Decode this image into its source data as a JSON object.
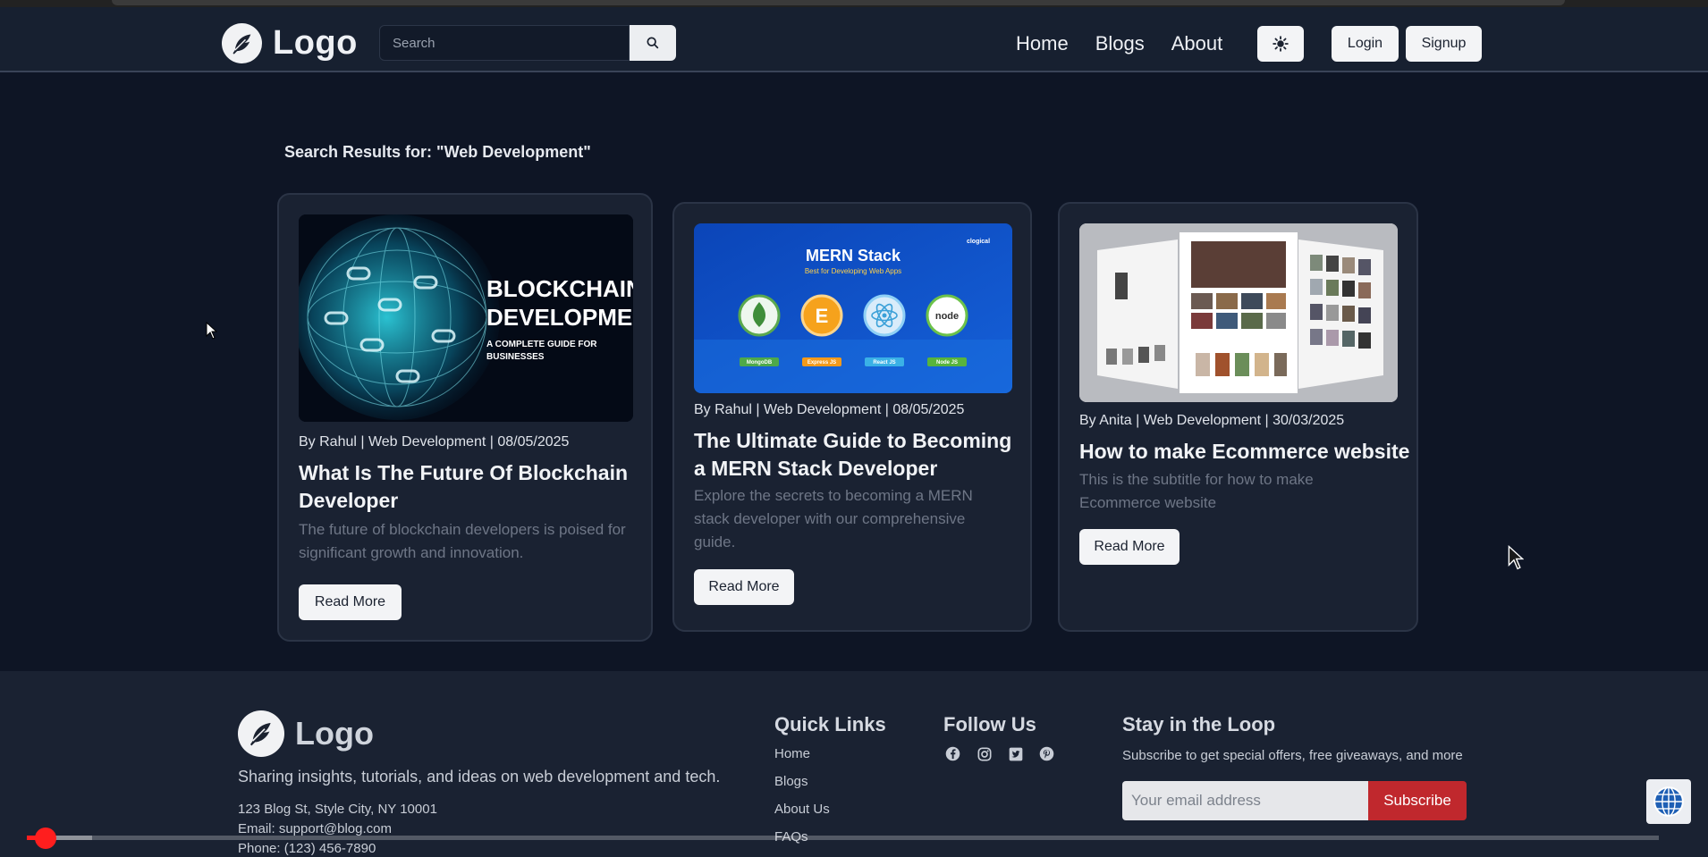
{
  "header": {
    "brand": "Logo",
    "search_placeholder": "Search",
    "nav": [
      "Home",
      "Blogs",
      "About"
    ],
    "login_label": "Login",
    "signup_label": "Signup"
  },
  "main": {
    "results_title": "Search Results for: \"Web Development\"",
    "cards": [
      {
        "image_text_line1": "BLOCKCHAIN",
        "image_text_line2": "DEVELOPMENT",
        "image_text_line3": "A COMPLETE GUIDE FOR",
        "image_text_line4": "BUSINESSES",
        "meta": "By Rahul | Web Development | 08/05/2025",
        "title": "What Is The Future Of Blockchain Developer",
        "subtitle": "The future of blockchain developers is poised for significant growth and innovation.",
        "button": "Read More"
      },
      {
        "image_title": "MERN Stack",
        "image_subtitle": "Best for Developing Web Apps",
        "image_tags": [
          "MongoDB",
          "Express JS",
          "React JS",
          "Node JS"
        ],
        "image_brand": "clogical",
        "meta": "By Rahul | Web Development | 08/05/2025",
        "title": "The Ultimate Guide to Becoming a MERN Stack Developer",
        "subtitle": "Explore the secrets to becoming a MERN stack developer with our comprehensive guide.",
        "button": "Read More"
      },
      {
        "meta": "By Anita | Web Development | 30/03/2025",
        "title": "How to make Ecommerce website",
        "subtitle": "This is the subtitle for how to make Ecommerce website",
        "button": "Read More"
      }
    ]
  },
  "footer": {
    "brand": "Logo",
    "tagline": "Sharing insights, tutorials, and ideas on web development and tech.",
    "address": "123 Blog St, Style City, NY 10001",
    "email": "Email: support@blog.com",
    "phone": "Phone: (123) 456-7890",
    "quick_links_title": "Quick Links",
    "quick_links": [
      "Home",
      "Blogs",
      "About Us",
      "FAQs"
    ],
    "follow_title": "Follow Us",
    "social_icons": [
      "facebook-icon",
      "instagram-icon",
      "twitter-icon",
      "pinterest-icon"
    ],
    "newsletter_title": "Stay in the Loop",
    "newsletter_text": "Subscribe to get special offers, free giveaways, and more",
    "email_placeholder": "Your email address",
    "subscribe_label": "Subscribe"
  },
  "video": {
    "played_fraction": 0.006,
    "buffered_fraction": 0.04
  },
  "colors": {
    "background": "#0e1525",
    "card": "#1a2232",
    "accent_red": "#c0282d"
  }
}
